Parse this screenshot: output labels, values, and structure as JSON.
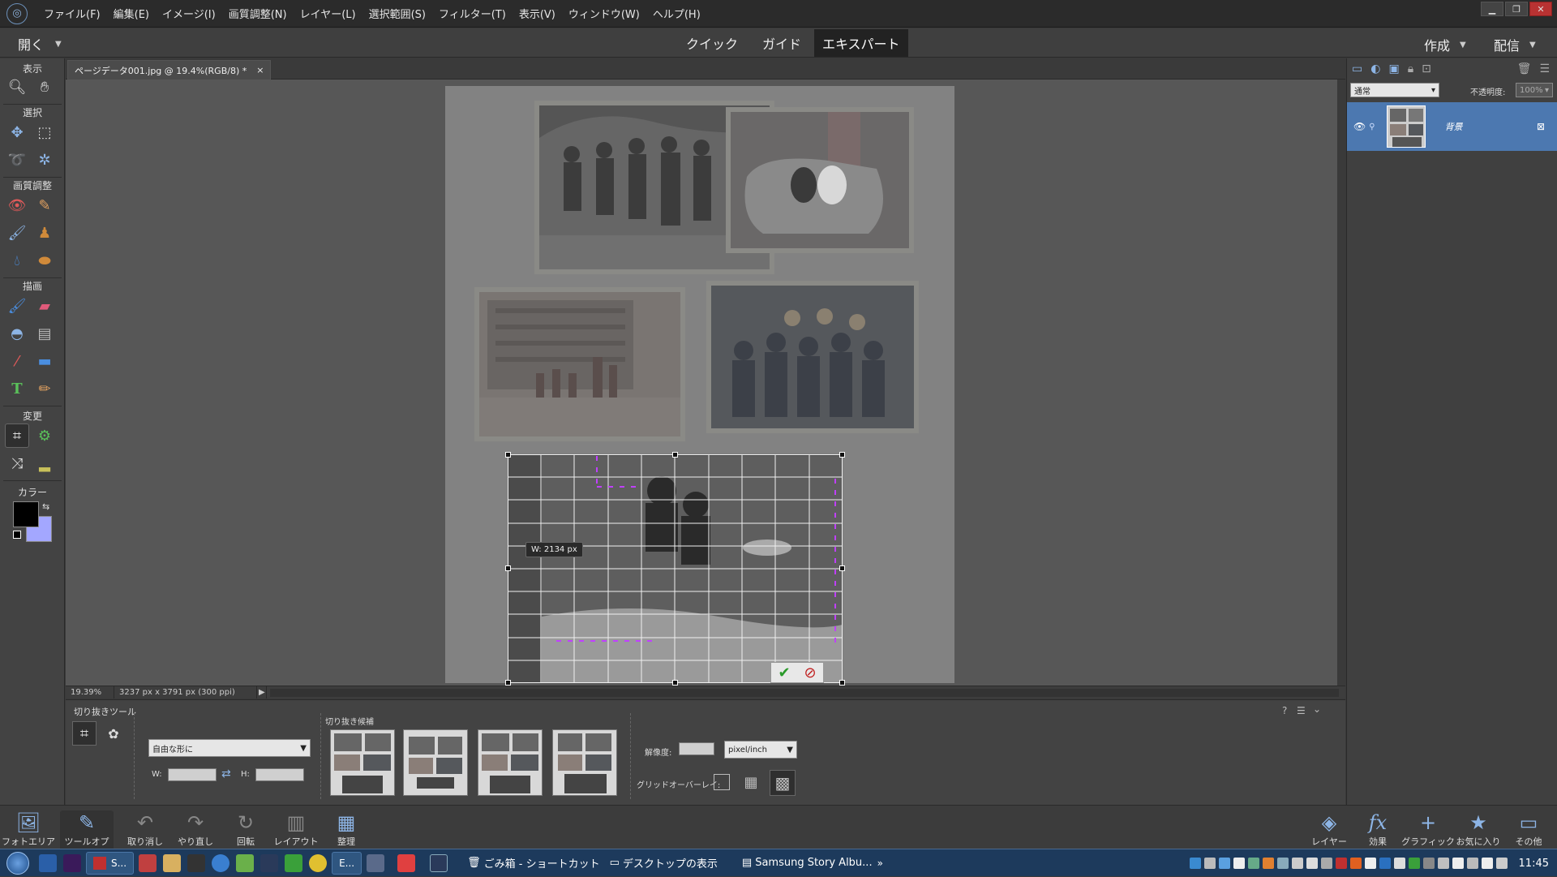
{
  "menubar": {
    "items": [
      "ファイル(F)",
      "編集(E)",
      "イメージ(I)",
      "画質調整(N)",
      "レイヤー(L)",
      "選択範囲(S)",
      "フィルター(T)",
      "表示(V)",
      "ウィンドウ(W)",
      "ヘルプ(H)"
    ]
  },
  "modebar": {
    "open_label": "開く",
    "tabs": [
      "クイック",
      "ガイド",
      "エキスパート"
    ],
    "active_tab": "エキスパート",
    "create_label": "作成",
    "share_label": "配信"
  },
  "toolbox": {
    "sections": [
      "表示",
      "選択",
      "画質調整",
      "描画",
      "変更",
      "カラー"
    ],
    "fg_color": "#000000",
    "bg_color": "#a3a7ff"
  },
  "document": {
    "tab_title": "ページデータ001.jpg @ 19.4%(RGB/8) *",
    "zoom": "19.39%",
    "dimensions": "3237 px x 3791 px (300 ppi)",
    "crop_width_readout": "W: 2134 px"
  },
  "layers_panel": {
    "blend_mode": "通常",
    "opacity_label": "不透明度:",
    "opacity_value": "100%",
    "layer_name": "背景"
  },
  "tool_options": {
    "tool_label": "切り抜きツール",
    "aspect_preset": "自由な形に",
    "w_label": "W:",
    "h_label": "H:",
    "suggestions_label": "切り抜き候補",
    "resolution_label": "解像度:",
    "resolution_unit": "pixel/inch",
    "grid_overlay_label": "グリッドオーバーレイ:"
  },
  "bottom_bar": {
    "left": [
      "フォトエリア",
      "ツールオプシ...",
      "取り消し",
      "やり直し",
      "回転",
      "レイアウト",
      "整理"
    ],
    "right": [
      "レイヤー",
      "効果",
      "グラフィック",
      "お気に入り",
      "その他"
    ]
  },
  "taskbar": {
    "task_s": "S...",
    "task_e": "E...",
    "recycle_link": "ごみ箱 - ショートカット",
    "desktop_link": "デスクトップの表示",
    "samsung_link": "Samsung Story Albu...",
    "clock": "11:45"
  }
}
